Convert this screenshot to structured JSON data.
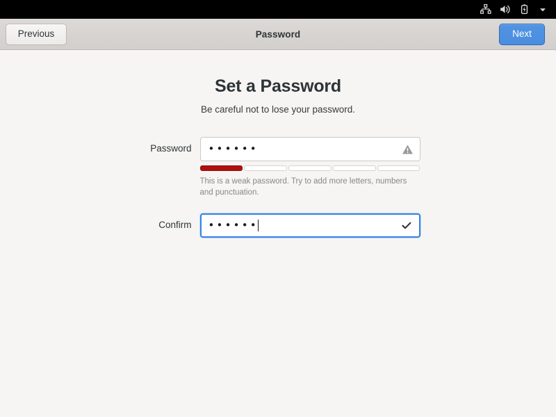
{
  "top_bar": {
    "icons": [
      {
        "name": "network-wired-icon",
        "label": "Wired network"
      },
      {
        "name": "volume-high-icon",
        "label": "Volume"
      },
      {
        "name": "battery-charging-icon",
        "label": "Battery charging"
      },
      {
        "name": "chevron-down-icon",
        "label": "System menu"
      }
    ]
  },
  "header": {
    "previous_label": "Previous",
    "title": "Password",
    "next_label": "Next"
  },
  "page": {
    "title": "Set a Password",
    "subtitle": "Be careful not to lose your password."
  },
  "form": {
    "password": {
      "label": "Password",
      "value": "••••••",
      "placeholder": "",
      "icon": "warning-triangle-icon",
      "focused": false
    },
    "confirm": {
      "label": "Confirm",
      "value": "••••••",
      "placeholder": "",
      "icon": "checkmark-icon",
      "focused": true
    }
  },
  "strength": {
    "segments_total": 5,
    "segments_filled": 1,
    "level": "weak",
    "fill_color": "#b0100f",
    "hint": "This is a weak password. Try to add more letters, numbers and punctuation."
  },
  "colors": {
    "accent": "#3584e4",
    "suggested_button": "#5294e2",
    "headerbar": "#d6d3d0",
    "content_bg": "#f6f5f4",
    "danger": "#b0100f"
  }
}
